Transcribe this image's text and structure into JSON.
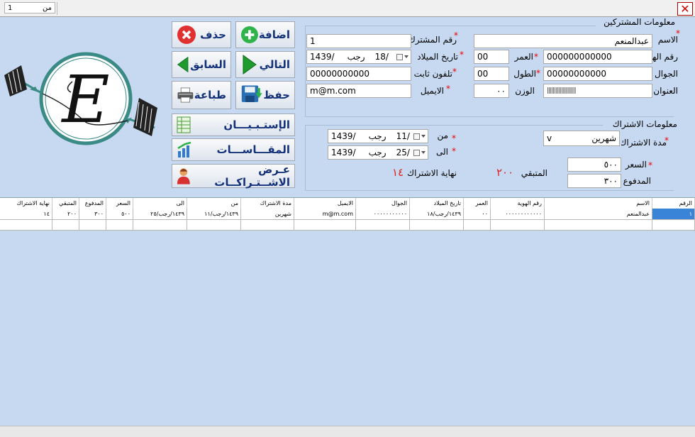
{
  "window": {
    "record_nav": {
      "label": "من",
      "value": "1",
      "current": "1"
    },
    "close_glyph": "✕"
  },
  "subscriber": {
    "section_title": "معلومات المشتركين",
    "name": {
      "label": "الاسم",
      "value": "عبدالمنعم"
    },
    "sub_no": {
      "label": "رقم المشترك",
      "value": "1"
    },
    "id_no": {
      "label": "رقم الهوية",
      "value": "000000000000"
    },
    "age": {
      "label": "العمر",
      "value": "00"
    },
    "birth_date": {
      "label": "تاريخ الميلاد",
      "day": "18/",
      "month": "رجب",
      "year": "1439/"
    },
    "mobile": {
      "label": "الجوال",
      "value": "00000000000"
    },
    "height": {
      "label": "الطول",
      "value": "00"
    },
    "phone": {
      "label": "تلفون ثابت",
      "value": "00000000000"
    },
    "address": {
      "label": "العنوان",
      "value": "||||||||||||||||||||"
    },
    "weight": {
      "label": "الوزن",
      "value": "٠٠"
    },
    "email": {
      "label": "الايميل",
      "value": "m@m.com"
    }
  },
  "subscription": {
    "section_title": "معلومات الاشتراك",
    "duration": {
      "label": "مدة الاشتراك",
      "value": "شهرين",
      "chevron": "v"
    },
    "from": {
      "label": "من",
      "day": "11/",
      "month": "رجب",
      "year": "1439/"
    },
    "to": {
      "label": "الى",
      "day": "25/",
      "month": "رجب",
      "year": "1439/"
    },
    "price": {
      "label": "السعر",
      "value": "٥٠٠"
    },
    "paid": {
      "label": "المدفوع",
      "value": "٣٠٠"
    },
    "remaining": {
      "label": "المتبقي",
      "value": "٢٠٠"
    },
    "end": {
      "label": "نهاية الاشتراك",
      "value": "١٤"
    }
  },
  "toolbar": {
    "add": "اضافة",
    "delete": "حذف",
    "next": "التالي",
    "prev": "السابق",
    "save": "حفظ",
    "print": "طباعة",
    "survey": "الإستـبـيـــان",
    "measures": "المقـــاســـات",
    "view_subs": "عـرض الاشــتـراكــات"
  },
  "logo": {
    "letter": "E"
  },
  "table": {
    "headers": [
      "الرقم",
      "الاسم",
      "رقم الهوية",
      "العمر",
      "تاريخ الميلاد",
      "الجوال",
      "الايميل",
      "مدة الاشتراك",
      "من",
      "الى",
      "السعر",
      "المدفوع",
      "المتبقي",
      "نهاية الاشتراك"
    ],
    "rows": [
      [
        "١",
        "عبدالمنعم",
        "٠٠٠٠٠٠٠٠٠٠٠٠",
        "٠٠",
        "١٤٣٩/رجب/١٨",
        "٠٠٠٠٠٠٠٠٠٠٠",
        "m@m.com",
        "شهرين",
        "١٤٣٩/رجب/١١",
        "١٤٣٩/رجب/٢٥",
        "٥٠٠",
        "٣٠٠",
        "٢٠٠",
        "١٤"
      ]
    ]
  },
  "colors": {
    "background": "#c6d9f0",
    "label_blue": "#14327a",
    "required_star": "#e00000",
    "accent_red": "#d22222",
    "add_green": "#2fb34a",
    "delete_red": "#e03030"
  }
}
